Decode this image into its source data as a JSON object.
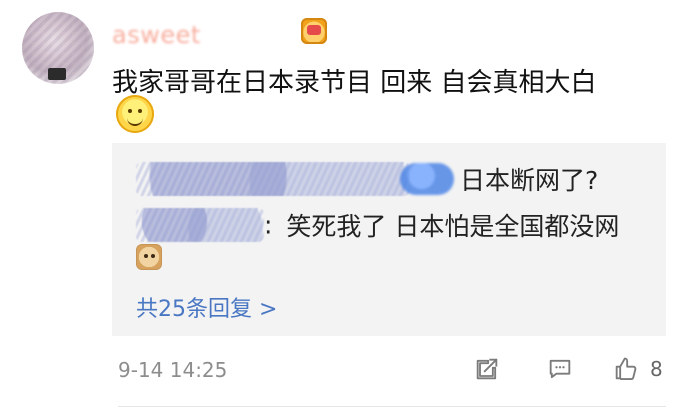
{
  "comment": {
    "username": "asweet",
    "text": "我家哥哥在日本录节目 回来 自会真相大白",
    "timestamp": "9-14 14:25",
    "like_count": "8",
    "icons": {
      "badge": "crown-badge-icon",
      "emoji": "smile-emoji-icon",
      "share": "share-icon",
      "comment": "comment-icon",
      "like": "like-icon"
    }
  },
  "replies": {
    "items": [
      {
        "text": "日本断网了?"
      },
      {
        "prefix": ":",
        "text": " 笑死我了 日本怕是全国都没网"
      }
    ],
    "more_text": "共25条回复 >"
  },
  "colors": {
    "username": "#f26b4f",
    "link": "#4a77c3",
    "panel_bg": "#f3f3f3",
    "meta_text": "#8d8d8d"
  }
}
